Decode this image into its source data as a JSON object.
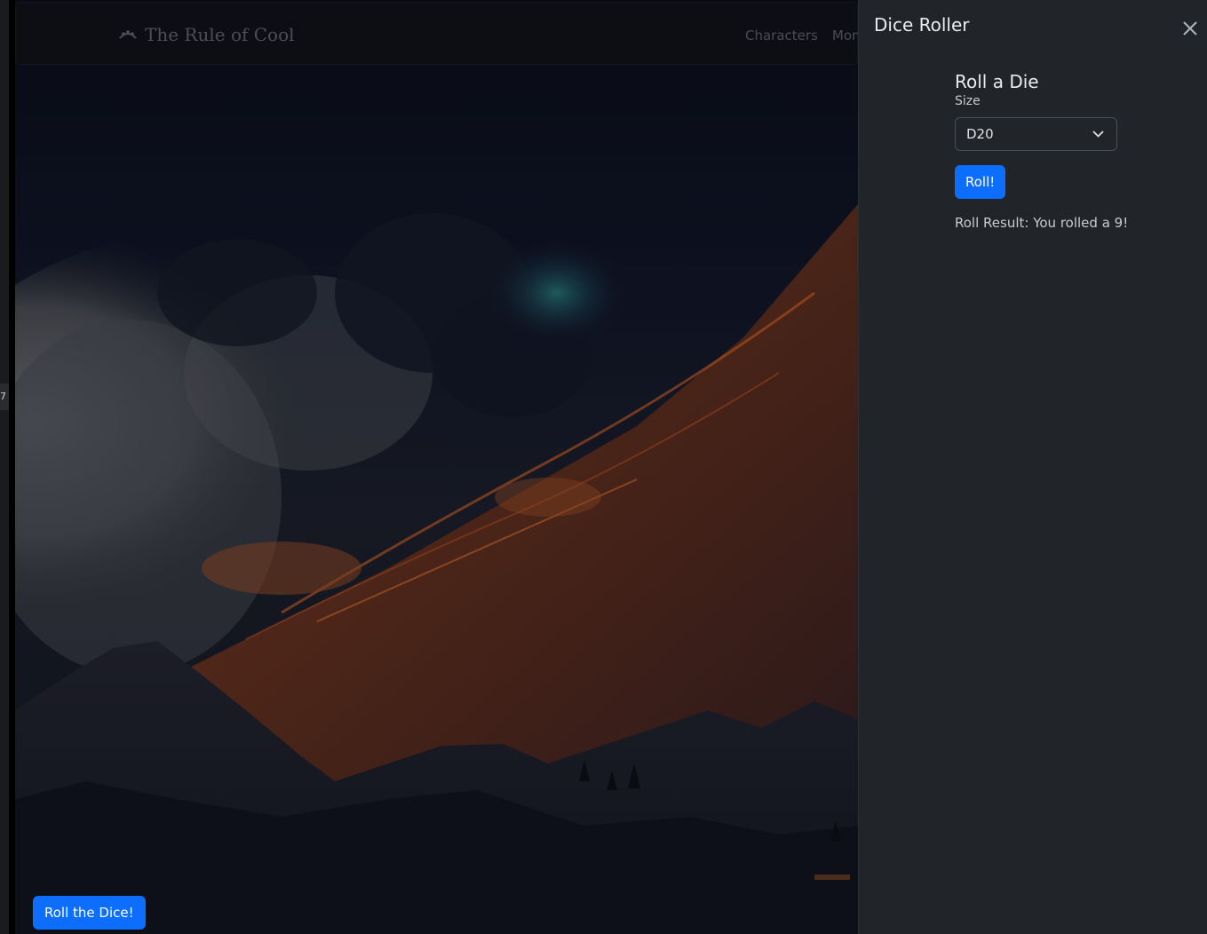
{
  "left_strip": {
    "tab_text": "7"
  },
  "navbar": {
    "brand": "The Rule of Cool",
    "brand_icon": "dice-cup-icon",
    "links": [
      "Characters",
      "Mons"
    ]
  },
  "floating_button": {
    "label": "Roll the Dice!"
  },
  "offcanvas": {
    "title": "Dice Roller",
    "close_icon": "close-icon",
    "form": {
      "heading": "Roll a Die",
      "size_label": "Size",
      "size_value": "D20",
      "roll_button": "Roll!",
      "result_text": "Roll Result: You rolled a 9!"
    }
  },
  "colors": {
    "primary": "#0d6efd",
    "panel_bg": "#212529",
    "lava": "#c2571f",
    "sky_glow": "#1f6f73"
  }
}
